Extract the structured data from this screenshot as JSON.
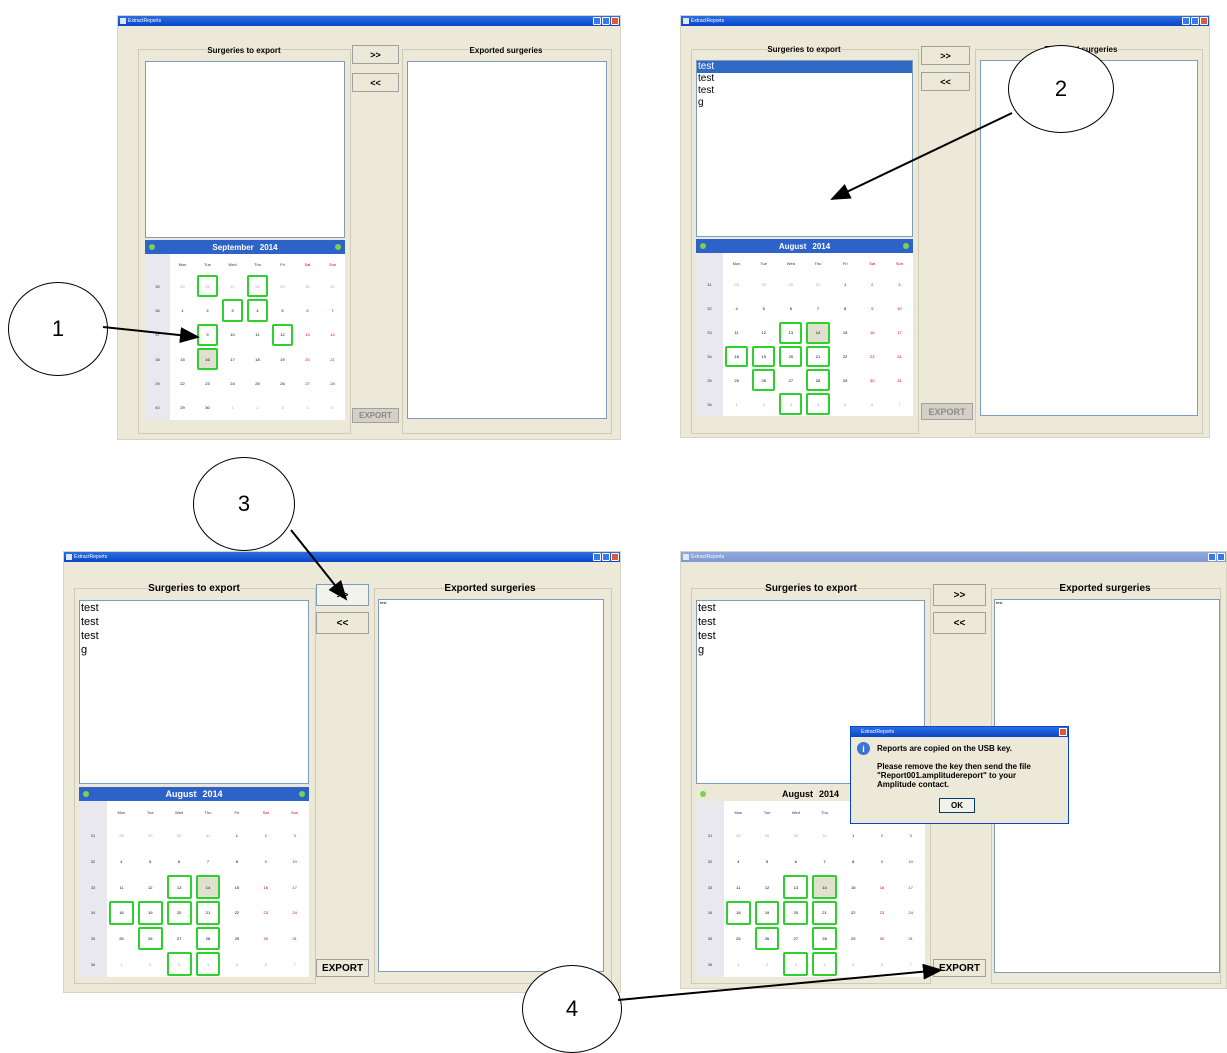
{
  "app_title": "ExtractReports",
  "labels": {
    "surgeries_to_export": "Surgeries to export",
    "exported_surgeries": "Exported surgeries",
    "add": ">>",
    "remove": "<<",
    "export": "EXPORT"
  },
  "calendar": {
    "september": {
      "month_label": "September",
      "year": "2014"
    },
    "august": {
      "month_label": "August",
      "year": "2014"
    },
    "weekdays": [
      "Mon",
      "Tue",
      "Wed",
      "Thu",
      "Fri",
      "Sat",
      "Sun"
    ],
    "september_weeks": [
      {
        "wk": "35",
        "days": [
          "25",
          "26",
          "27",
          "28",
          "29",
          "30",
          "31"
        ]
      },
      {
        "wk": "36",
        "days": [
          "1",
          "2",
          "3",
          "4",
          "5",
          "6",
          "7"
        ]
      },
      {
        "wk": "37",
        "days": [
          "8",
          "9",
          "10",
          "11",
          "12",
          "13",
          "14"
        ]
      },
      {
        "wk": "38",
        "days": [
          "15",
          "16",
          "17",
          "18",
          "19",
          "20",
          "21"
        ]
      },
      {
        "wk": "39",
        "days": [
          "22",
          "23",
          "24",
          "25",
          "26",
          "27",
          "28"
        ]
      },
      {
        "wk": "40",
        "days": [
          "29",
          "30",
          "1",
          "2",
          "3",
          "4",
          "5"
        ]
      }
    ],
    "august_weeks": [
      {
        "wk": "31",
        "days": [
          "28",
          "29",
          "30",
          "31",
          "1",
          "2",
          "3"
        ]
      },
      {
        "wk": "32",
        "days": [
          "4",
          "5",
          "6",
          "7",
          "8",
          "9",
          "10"
        ]
      },
      {
        "wk": "33",
        "days": [
          "11",
          "12",
          "13",
          "14",
          "15",
          "16",
          "17"
        ]
      },
      {
        "wk": "34",
        "days": [
          "18",
          "19",
          "20",
          "21",
          "22",
          "23",
          "24"
        ]
      },
      {
        "wk": "35",
        "days": [
          "25",
          "26",
          "27",
          "28",
          "29",
          "30",
          "31"
        ]
      },
      {
        "wk": "36",
        "days": [
          "1",
          "2",
          "3",
          "4",
          "5",
          "6",
          "7"
        ]
      }
    ]
  },
  "surgery_list": [
    "test",
    "test",
    "test",
    "g"
  ],
  "exported_list": [
    "test"
  ],
  "dialog": {
    "title": "ExtractReports",
    "line1": "Reports are copied on the USB key.",
    "line2": "Please remove the key then send the file",
    "line3": "\"Report001.amplitudereport\" to your",
    "line4": "Amplitude contact.",
    "ok": "OK"
  },
  "callouts": [
    "1",
    "2",
    "3",
    "4"
  ],
  "colors": {
    "window_bg": "#ece9d8",
    "titlebar": "#0a46c8",
    "calendar_header": "#2d62c8",
    "selection": "#316ac5",
    "marked_day_border": "#2ed02e",
    "weekend_text": "#cc0000"
  }
}
